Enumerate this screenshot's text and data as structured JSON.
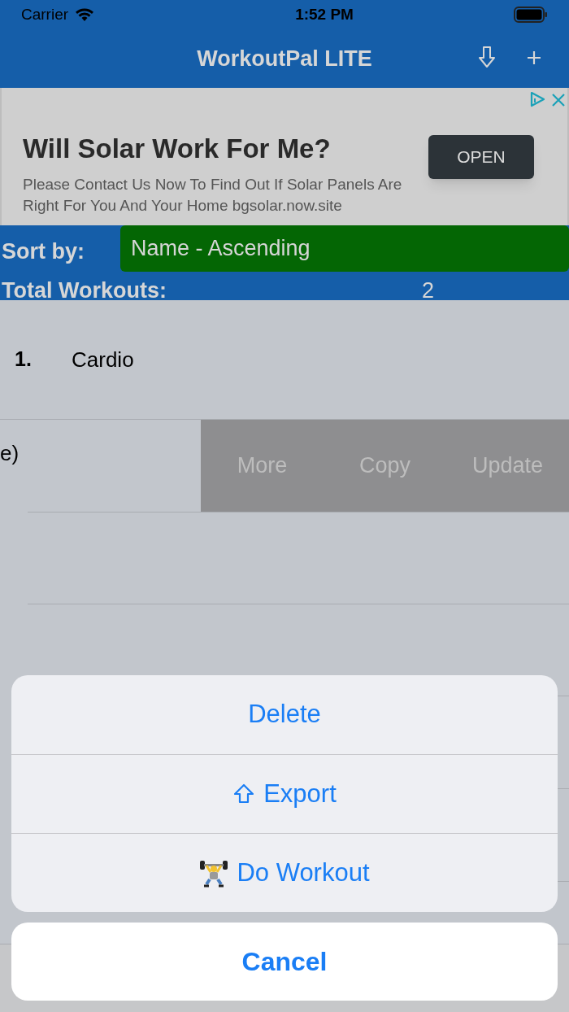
{
  "status_bar": {
    "carrier": "Carrier",
    "time": "1:52 PM"
  },
  "nav": {
    "title": "WorkoutPal LITE"
  },
  "ad": {
    "headline": "Will Solar Work For Me?",
    "body": "Please Contact Us Now To Find Out If Solar Panels Are Right For You And Your Home bgsolar.now.site",
    "button": "OPEN"
  },
  "sort": {
    "label": "Sort by:",
    "value": "Name - Ascending"
  },
  "total": {
    "label": "Total Workouts:",
    "value": "2"
  },
  "workouts": [
    {
      "number": "1.",
      "name": "Cardio",
      "swiped": false
    },
    {
      "name": "e)",
      "swiped": true,
      "actions": [
        "More",
        "Copy",
        "Update"
      ]
    }
  ],
  "action_sheet": {
    "items": [
      {
        "label": "Delete",
        "kind": "plain"
      },
      {
        "label": "Export",
        "kind": "export"
      },
      {
        "label": "Do Workout",
        "kind": "lifter"
      }
    ],
    "cancel": "Cancel"
  }
}
